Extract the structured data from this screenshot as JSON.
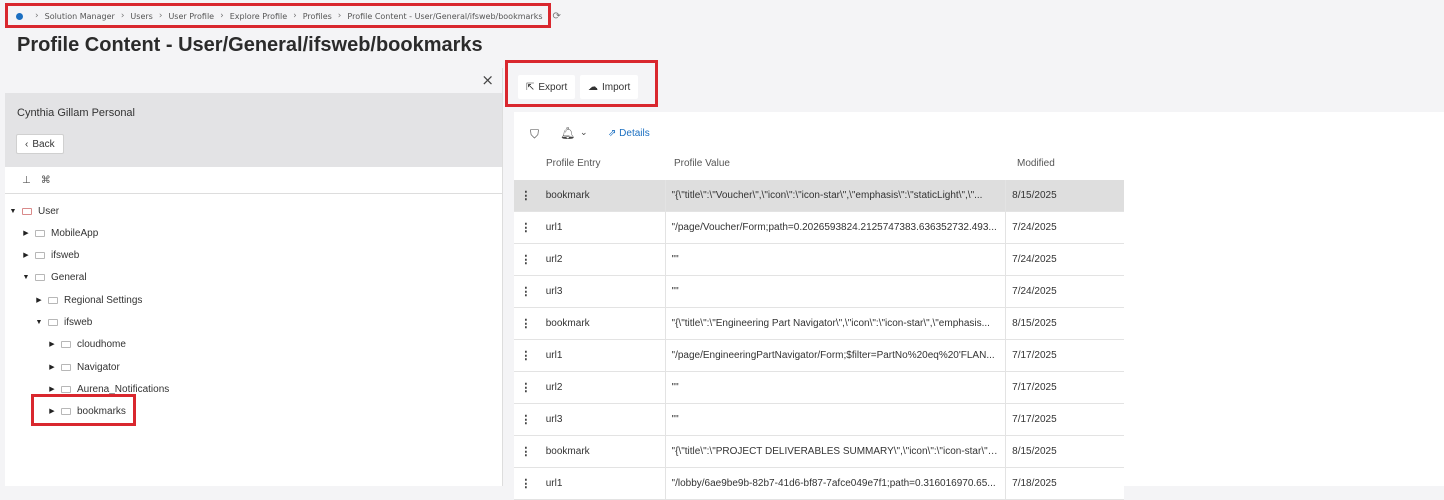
{
  "breadcrumb": [
    "Solution Manager",
    "Users",
    "User Profile",
    "Explore Profile",
    "Profiles",
    "Profile Content - User/General/ifsweb/bookmarks"
  ],
  "page_title": "Profile Content - User/General/ifsweb/bookmarks",
  "left_panel": {
    "person": "Cynthia Gillam Personal",
    "back_label": "Back",
    "tree": [
      {
        "label": "User",
        "expanded": true
      },
      {
        "label": "MobileApp",
        "expanded": false
      },
      {
        "label": "ifsweb",
        "expanded": false
      },
      {
        "label": "General",
        "expanded": true
      },
      {
        "label": "Regional Settings",
        "expanded": false
      },
      {
        "label": "ifsweb",
        "expanded": true
      },
      {
        "label": "cloudhome",
        "expanded": false
      },
      {
        "label": "Navigator",
        "expanded": false
      },
      {
        "label": "Aurena_Notifications",
        "expanded": false
      },
      {
        "label": "bookmarks",
        "expanded": false
      }
    ]
  },
  "toolbar": {
    "export_label": "Export",
    "import_label": "Import"
  },
  "grid": {
    "details_label": "Details",
    "columns": [
      "Profile Entry",
      "Profile Value",
      "Modified"
    ],
    "rows": [
      {
        "entry": "bookmark",
        "value": "\"{\\\"title\\\":\\\"Voucher\\\",\\\"icon\\\":\\\"icon-star\\\",\\\"emphasis\\\":\\\"staticLight\\\",\\\"...",
        "modified": "8/15/2025"
      },
      {
        "entry": "url1",
        "value": "\"/page/Voucher/Form;path=0.2026593824.2125747383.636352732.493...",
        "modified": "7/24/2025"
      },
      {
        "entry": "url2",
        "value": "\"\"",
        "modified": "7/24/2025"
      },
      {
        "entry": "url3",
        "value": "\"\"",
        "modified": "7/24/2025"
      },
      {
        "entry": "bookmark",
        "value": "\"{\\\"title\\\":\\\"Engineering Part Navigator\\\",\\\"icon\\\":\\\"icon-star\\\",\\\"emphasis...",
        "modified": "8/15/2025"
      },
      {
        "entry": "url1",
        "value": "\"/page/EngineeringPartNavigator/Form;$filter=PartNo%20eq%20'FLAN...",
        "modified": "7/17/2025"
      },
      {
        "entry": "url2",
        "value": "\"\"",
        "modified": "7/17/2025"
      },
      {
        "entry": "url3",
        "value": "\"\"",
        "modified": "7/17/2025"
      },
      {
        "entry": "bookmark",
        "value": "\"{\\\"title\\\":\\\"PROJECT DELIVERABLES SUMMARY\\\",\\\"icon\\\":\\\"icon-star\\\",\\\"e...",
        "modified": "8/15/2025"
      },
      {
        "entry": "url1",
        "value": "\"/lobby/6ae9be9b-82b7-41d6-bf87-7afce049e7f1;path=0.316016970.65...",
        "modified": "7/18/2025"
      }
    ]
  },
  "highlight_color": "#d9272e",
  "accent_color": "#1b6fc1"
}
